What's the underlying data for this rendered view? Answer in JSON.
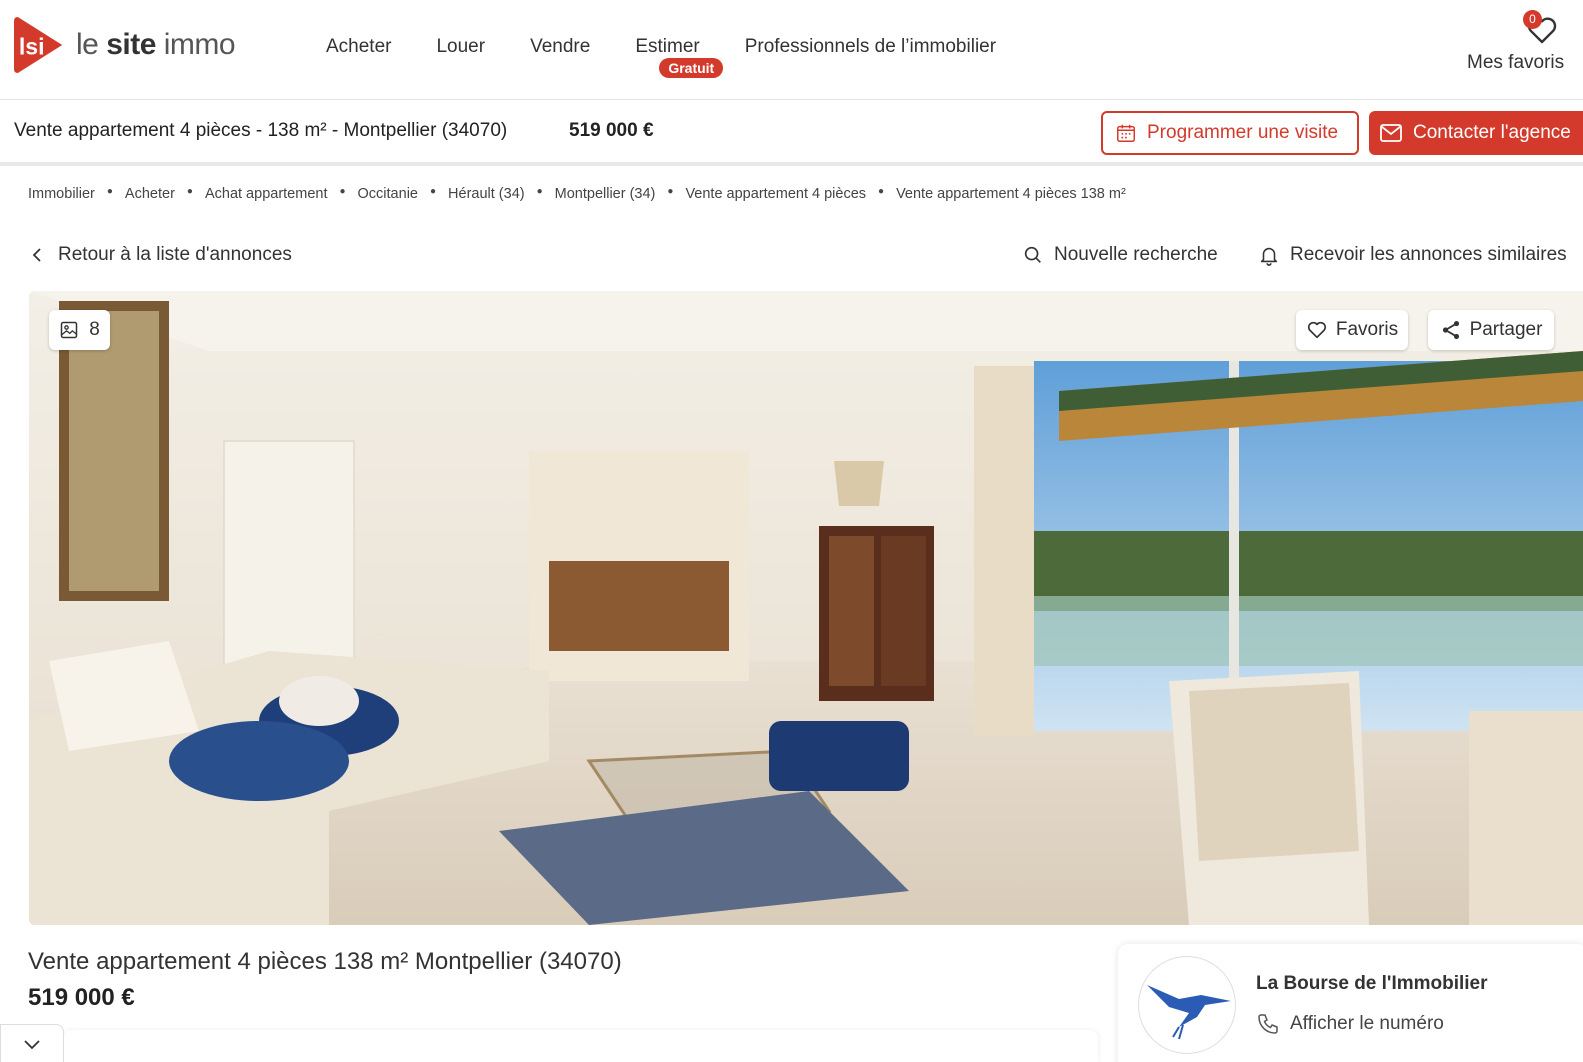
{
  "header": {
    "logo_text_le": "le",
    "logo_text_site": "site",
    "logo_text_immo": "immo",
    "nav": [
      {
        "label": "Acheter"
      },
      {
        "label": "Louer"
      },
      {
        "label": "Vendre"
      },
      {
        "label": "Estimer",
        "badge": "Gratuit"
      },
      {
        "label": "Professionnels de l’immobilier"
      }
    ],
    "favorites_label": "Mes favoris",
    "favorites_count": "0"
  },
  "listing_bar": {
    "title": "Vente appartement 4 pièces - 138 m² - Montpellier (34070)",
    "price": "519 000 €",
    "visit_button": "Programmer une visite",
    "contact_button": "Contacter l'agence"
  },
  "breadcrumb": [
    "Immobilier",
    "Acheter",
    "Achat appartement",
    "Occitanie",
    "Hérault (34)",
    "Montpellier (34)",
    "Vente appartement 4 pièces",
    "Vente appartement 4 pièces 138 m²"
  ],
  "actions": {
    "back": "Retour à la liste d'annonces",
    "new_search": "Nouvelle recherche",
    "alert": "Recevoir les annonces similaires"
  },
  "photo": {
    "count": "8",
    "favorite": "Favoris",
    "share": "Partager"
  },
  "listing": {
    "title": "Vente appartement 4 pièces 138 m² Montpellier (34070)",
    "price": "519 000 €"
  },
  "agency": {
    "name": "La Bourse de l'Immobilier",
    "phone_label": "Afficher le numéro"
  },
  "colors": {
    "brand": "#d33a2c",
    "text": "#222222"
  }
}
